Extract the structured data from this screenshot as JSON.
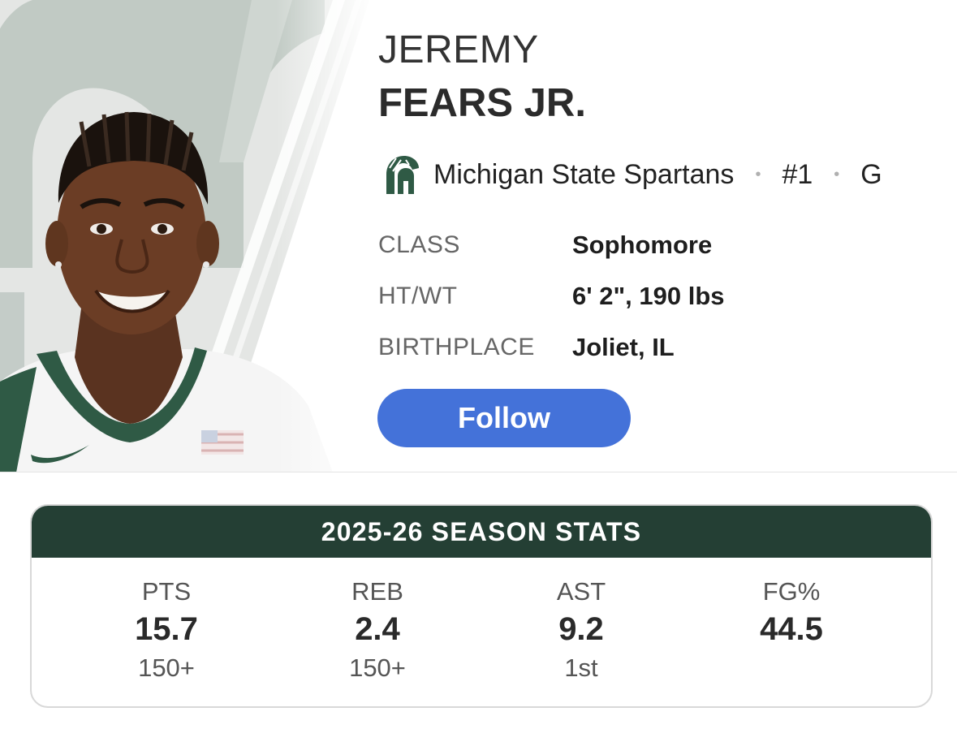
{
  "player": {
    "first_name": "JEREMY",
    "last_name": "FEARS JR.",
    "team": "Michigan State Spartans",
    "number": "#1",
    "position": "G",
    "team_logo_icon": "spartan-helmet-icon",
    "photo": "player-headshot"
  },
  "bio": [
    {
      "label": "CLASS",
      "value": "Sophomore"
    },
    {
      "label": "HT/WT",
      "value": "6' 2\", 190 lbs"
    },
    {
      "label": "BIRTHPLACE",
      "value": "Joliet, IL"
    }
  ],
  "follow_label": "Follow",
  "stats": {
    "title": "2025-26 SEASON STATS",
    "items": [
      {
        "label": "PTS",
        "value": "15.7",
        "rank": "150+"
      },
      {
        "label": "REB",
        "value": "2.4",
        "rank": "150+"
      },
      {
        "label": "AST",
        "value": "9.2",
        "rank": "1st"
      },
      {
        "label": "FG%",
        "value": "44.5",
        "rank": ""
      }
    ]
  },
  "colors": {
    "team_green": "#243f34",
    "follow_blue": "#4472d9",
    "backdrop_gray": "#e4e6e4",
    "logo_gray": "#bcc6c0"
  }
}
